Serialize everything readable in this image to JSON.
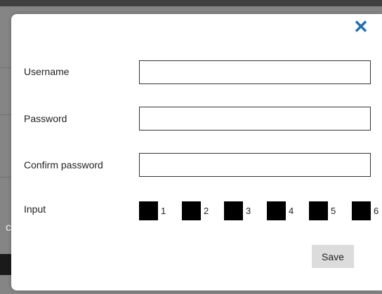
{
  "dialog": {
    "close_icon": "close-icon",
    "accent_color": "#1f6fb2",
    "fields": {
      "username": {
        "label": "Username",
        "value": ""
      },
      "password": {
        "label": "Password",
        "value": ""
      },
      "confirm_password": {
        "label": "Confirm password",
        "value": ""
      }
    },
    "input_group": {
      "label": "Input",
      "options": [
        "1",
        "2",
        "3",
        "4",
        "5",
        "6"
      ]
    },
    "save_label": "Save"
  },
  "background": {
    "glyph": "c"
  }
}
